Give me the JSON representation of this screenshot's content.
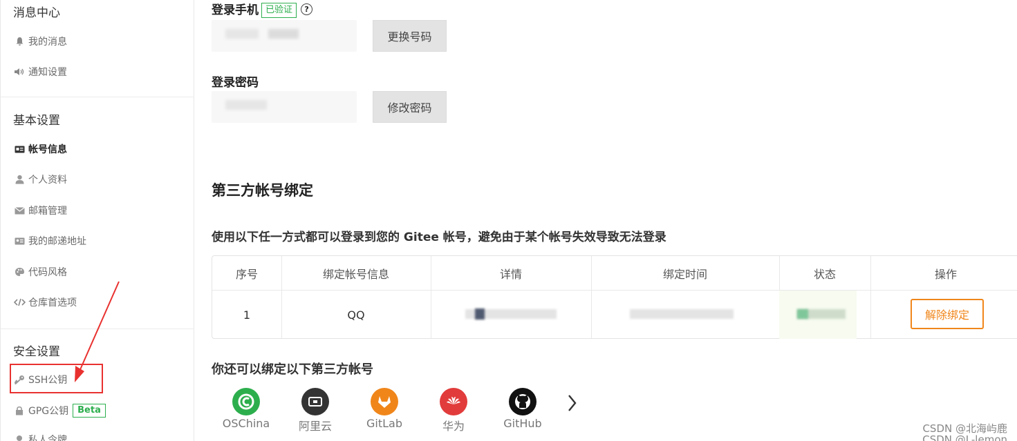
{
  "sidebar": {
    "messages": {
      "title": "消息中心",
      "items": [
        "我的消息",
        "通知设置"
      ]
    },
    "basic": {
      "title": "基本设置",
      "items": [
        "帐号信息",
        "个人资料",
        "邮箱管理",
        "我的邮递地址",
        "代码风格",
        "仓库首选项"
      ]
    },
    "security": {
      "title": "安全设置",
      "items": [
        "SSH公钥",
        "GPG公钥",
        "私人令牌"
      ],
      "beta_label": "Beta"
    }
  },
  "account": {
    "phone_label": "登录手机",
    "verified_label": "已验证",
    "help_icon": "?",
    "change_phone_button": "更换号码",
    "password_label": "登录密码",
    "change_password_button": "修改密码"
  },
  "third_party": {
    "title": "第三方帐号绑定",
    "description": "使用以下任一方式都可以登录到您的 Gitee 帐号，避免由于某个帐号失效导致无法登录",
    "columns": [
      "序号",
      "绑定帐号信息",
      "详情",
      "绑定时间",
      "状态",
      "操作"
    ],
    "rows": [
      {
        "index": "1",
        "account": "QQ",
        "action": "解除绑定"
      }
    ],
    "more_title": "你还可以绑定以下第三方帐号",
    "providers": [
      {
        "name": "OSChina",
        "icon": "oschina-icon",
        "color": "#2cae4d"
      },
      {
        "name": "阿里云",
        "icon": "aliyun-icon",
        "color": "#333333"
      },
      {
        "name": "GitLab",
        "icon": "gitlab-icon",
        "color": "#f0861a"
      },
      {
        "name": "华为",
        "icon": "huawei-icon",
        "color": "#e23b3b"
      },
      {
        "name": "GitHub",
        "icon": "github-icon",
        "color": "#111111"
      }
    ]
  },
  "watermark": {
    "line1": "CSDN @北海屿鹿",
    "line2": "CSDN @L-lemon"
  },
  "colors": {
    "accent_green": "#2cae4d",
    "accent_orange": "#f0861a",
    "annotation_red": "#e8312f"
  }
}
